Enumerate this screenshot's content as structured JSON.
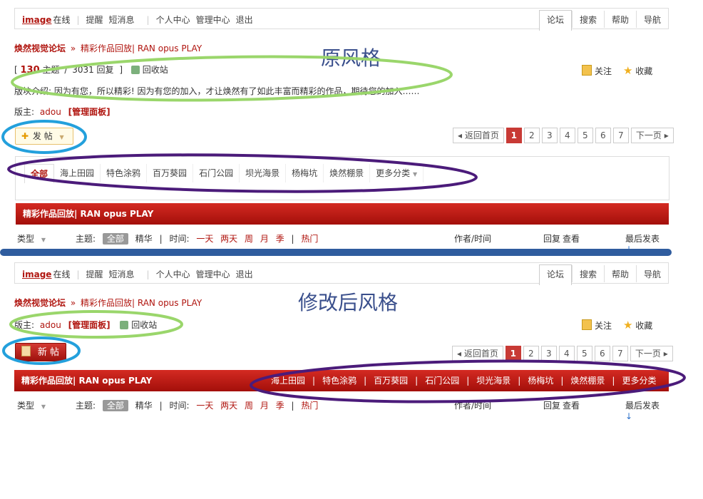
{
  "top": {
    "brand": "image",
    "online": "在线",
    "remind": "提醒",
    "sms": "短消息",
    "uc": "个人中心",
    "admin": "管理中心",
    "logout": "退出",
    "tabs": [
      "论坛",
      "搜索",
      "帮助",
      "导航"
    ]
  },
  "crumb": {
    "forum": "焕然视觉论坛",
    "sep": "»",
    "board": "精彩作品回放| RAN opus PLAY"
  },
  "annot_old": "原风格",
  "annot_new": "修改后风格",
  "stats": {
    "lb": "[",
    "topics": "130",
    "topics_label": "主题",
    "slash": "/",
    "posts": "3031 回复",
    "rb": "]",
    "recycle": "回收站"
  },
  "intro": "版块介绍: 因为有您，所以精彩!  因为有您的加入，才让焕然有了如此丰富而精彩的作品，期待您的加入……",
  "moderator": {
    "label": "版主:",
    "name": "adou",
    "panel": "[管理面板]"
  },
  "follow": "关注",
  "favorite": "收藏",
  "post_btn_old": "发 帖",
  "post_btn_new": "新 帖",
  "pager": {
    "home": "返回首页",
    "pages": [
      "1",
      "2",
      "3",
      "4",
      "5",
      "6",
      "7"
    ],
    "next": "下一页"
  },
  "categories": [
    "全部",
    "海上田园",
    "特色涂鸦",
    "百万葵园",
    "石门公园",
    "坝光海景",
    "杨梅坑",
    "焕然棚景",
    "更多分类"
  ],
  "categories2": [
    "海上田园",
    "特色涂鸦",
    "百万葵园",
    "石门公园",
    "坝光海景",
    "杨梅坑",
    "焕然棚景",
    "更多分类"
  ],
  "redbar_title": "精彩作品回放| RAN opus PLAY",
  "filter": {
    "type": "类型",
    "subject": "主题:",
    "all": "全部",
    "digest": "精华",
    "time": "时间:",
    "times": [
      "一天",
      "两天",
      "周",
      "月",
      "季"
    ],
    "hot": "热门",
    "author": "作者/时间",
    "reply": "回复",
    "view": "查看",
    "last": "最后发表"
  },
  "colors": {
    "accent": "#b0150f",
    "annot": "#3a4f8c",
    "green": "#9ad66b",
    "blue": "#23a0dc",
    "purple": "#4b1b7a",
    "divider": "#2f5c9e"
  }
}
